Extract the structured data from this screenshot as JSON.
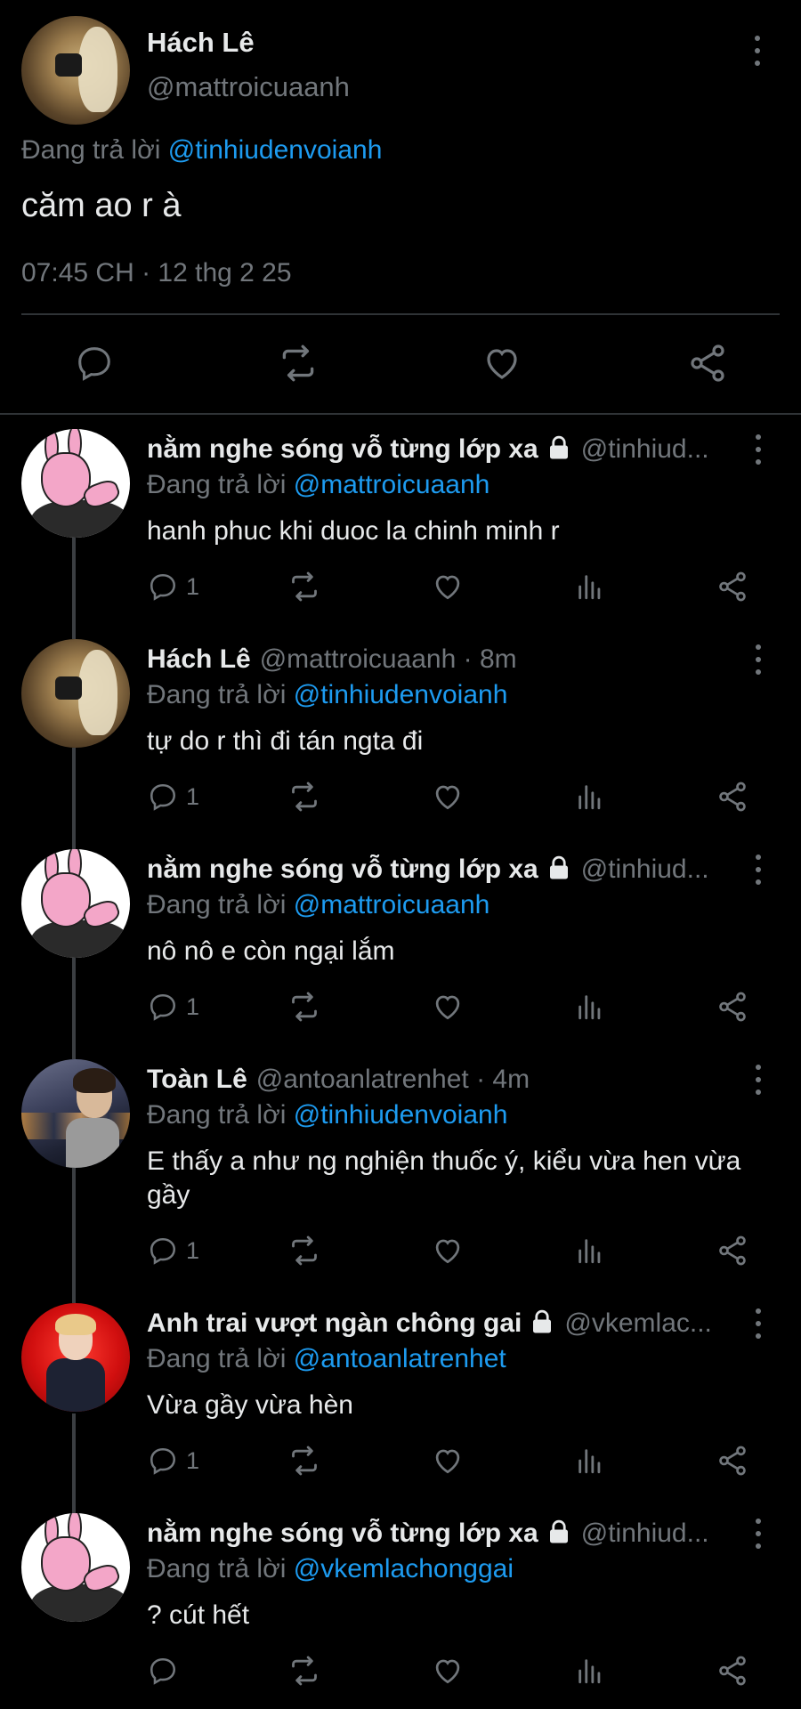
{
  "main_tweet": {
    "name": "Hách Lê",
    "handle": "@mattroicuaanh",
    "replying_prefix": "Đang trả lời",
    "replying_to": "@tinhiudenvoianh",
    "text": "căm ao r à",
    "timestamp": "07:45 CH · 12 thg 2 25"
  },
  "replies": [
    {
      "name": "nằm nghe sóng vỗ từng lớp xa",
      "locked": true,
      "handle": "@tinhiud...",
      "replying_prefix": "Đang trả lời",
      "replying_to": "@mattroicuaanh",
      "text": "hanh phuc khi duoc la chinh minh r",
      "reply_count": "1",
      "avatar": "bunny"
    },
    {
      "name": "Hách Lê",
      "locked": false,
      "handle": "@mattroicuaanh · 8m",
      "replying_prefix": "Đang trả lời",
      "replying_to": "@tinhiudenvoianh",
      "text": "tự do r thì đi tán ngta đi",
      "reply_count": "1",
      "avatar": "hach"
    },
    {
      "name": "nằm nghe sóng vỗ từng lớp xa",
      "locked": true,
      "handle": "@tinhiud...",
      "replying_prefix": "Đang trả lời",
      "replying_to": "@mattroicuaanh",
      "text": "nô nô e còn ngại lắm",
      "reply_count": "1",
      "avatar": "bunny"
    },
    {
      "name": "Toàn Lê",
      "locked": false,
      "handle": "@antoanlatrenhet · 4m",
      "replying_prefix": "Đang trả lời",
      "replying_to": "@tinhiudenvoianh",
      "text": "E thấy a như ng nghiện thuốc ý, kiểu vừa hen vừa gầy",
      "reply_count": "1",
      "avatar": "toan"
    },
    {
      "name": "Anh trai vượt ngàn chông gai",
      "locked": true,
      "handle": "@vkemlac...",
      "replying_prefix": "Đang trả lời",
      "replying_to": "@antoanlatrenhet",
      "text": "Vừa gầy vừa hèn",
      "reply_count": "1",
      "avatar": "anh"
    },
    {
      "name": "nằm nghe sóng vỗ từng lớp xa",
      "locked": true,
      "handle": "@tinhiud...",
      "replying_prefix": "Đang trả lời",
      "replying_to": "@vkemlachonggai",
      "text": "? cút hết",
      "reply_count": "",
      "avatar": "bunny"
    }
  ],
  "colors": {
    "background": "#000000",
    "text": "#e7e9ea",
    "muted": "#71767b",
    "link": "#1d9bf0",
    "divider": "#2f3336"
  },
  "icons": [
    "reply-icon",
    "retweet-icon",
    "like-icon",
    "views-icon",
    "share-icon",
    "more-icon",
    "lock-icon"
  ]
}
